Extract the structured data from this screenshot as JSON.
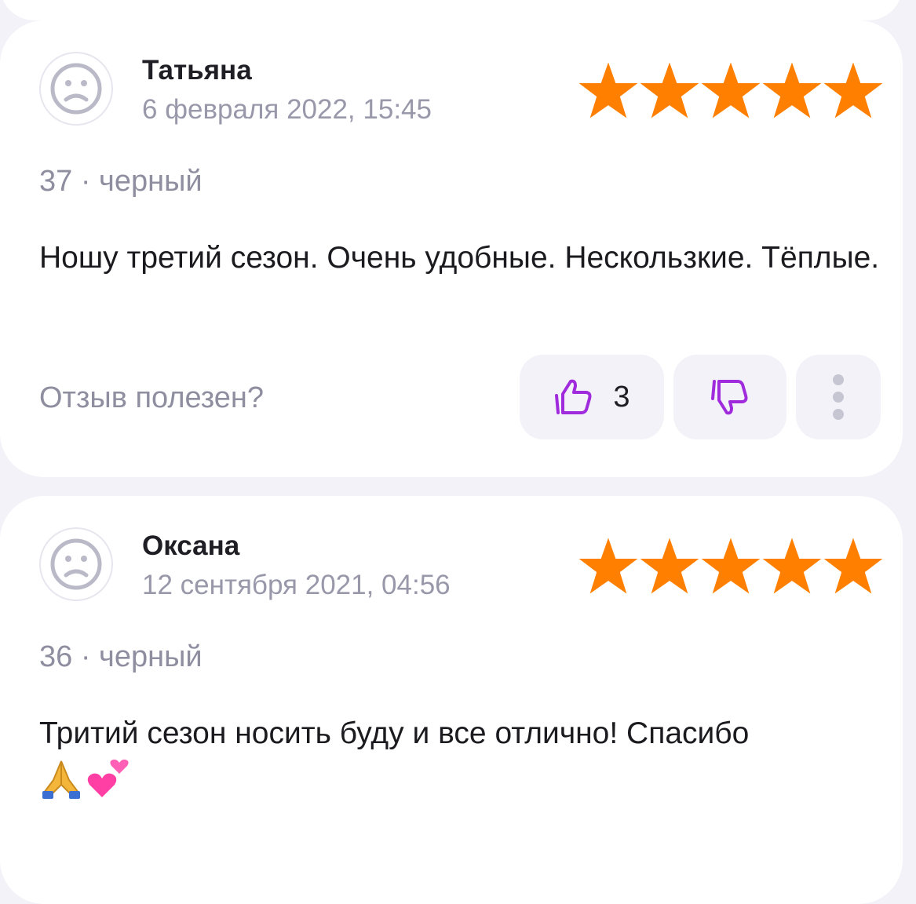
{
  "reviews": [
    {
      "author": "Татьяна",
      "date": "6 февраля 2022, 15:45",
      "rating": 5,
      "size_color": "37 · черный",
      "text": "Ношу третий сезон. Очень удобные. Нескользкие. Тёплые.",
      "helpful_label": "Отзыв полезен?",
      "likes": "3"
    },
    {
      "author": "Оксана",
      "date": "12 сентября 2021, 04:56",
      "rating": 5,
      "size_color": "36 · черный",
      "text": "Тритий сезон носить буду и все отлично! Спасибо",
      "emoji": [
        "folded-hands-emoji",
        "two-hearts-emoji"
      ]
    }
  ],
  "icons": {
    "avatar": "sad-face-icon",
    "star": "star-icon",
    "like": "thumbs-up-icon",
    "dislike": "thumbs-down-icon",
    "more": "more-vertical-icon"
  },
  "colors": {
    "star": "#ff8000",
    "accent": "#a02bdc",
    "muted_text": "#8e8ea0",
    "button_bg": "#f2f2f8"
  }
}
